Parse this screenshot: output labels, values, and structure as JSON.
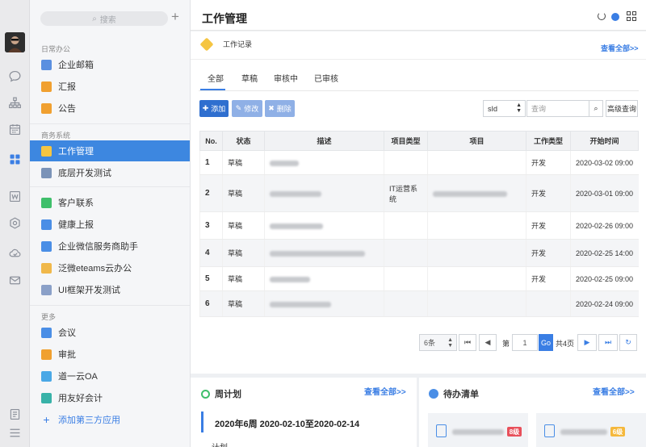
{
  "search": {
    "placeholder": "搜索",
    "icon": "search-icon"
  },
  "sidebar": {
    "sections": [
      "日常办公",
      "商务系统",
      "更多"
    ],
    "items": [
      {
        "label": "企业邮箱",
        "color": "#5a8fe0"
      },
      {
        "label": "汇报",
        "color": "#f0a030"
      },
      {
        "label": "公告",
        "color": "#f0a030"
      },
      {
        "label": "工作管理",
        "color": "#f5c542"
      },
      {
        "label": "底层开发测试",
        "color": "#7b93b8"
      },
      {
        "label": "客户联系",
        "color": "#3fbf6b"
      },
      {
        "label": "健康上报",
        "color": "#4a8ee6"
      },
      {
        "label": "企业微信服务商助手",
        "color": "#4a8ee6"
      },
      {
        "label": "泛微eteams云办公",
        "color": "#f0b84a"
      },
      {
        "label": "UI框架开发测试",
        "color": "#8aa0c8"
      },
      {
        "label": "会议",
        "color": "#4a8ee6"
      },
      {
        "label": "审批",
        "color": "#f0a030"
      },
      {
        "label": "道一云OA",
        "color": "#4aa8e6"
      },
      {
        "label": "用友好会计",
        "color": "#38b2a8"
      }
    ],
    "add_app": "添加第三方应用"
  },
  "header": {
    "title": "工作管理"
  },
  "work_record": {
    "title": "工作记录",
    "view_all": "查看全部>>"
  },
  "tabs": [
    "全部",
    "草稿",
    "审核中",
    "已审核"
  ],
  "toolbar": {
    "add": "添加",
    "edit": "修改",
    "delete": "删除",
    "field_select": "sId",
    "query_placeholder": "查询",
    "advanced": "高级查询"
  },
  "table": {
    "columns": [
      "No.",
      "状态",
      "描述",
      "项目类型",
      "项目",
      "工作类型",
      "开始时间"
    ],
    "rows": [
      {
        "no": "1",
        "status": "草稿",
        "project_type": "",
        "work_type": "开发",
        "start": "2020-03-02 09:00"
      },
      {
        "no": "2",
        "status": "草稿",
        "project_type": "IT运营系统",
        "work_type": "开发",
        "start": "2020-03-01 09:00"
      },
      {
        "no": "3",
        "status": "草稿",
        "project_type": "",
        "work_type": "开发",
        "start": "2020-02-26 09:00"
      },
      {
        "no": "4",
        "status": "草稿",
        "project_type": "",
        "work_type": "开发",
        "start": "2020-02-25 14:00"
      },
      {
        "no": "5",
        "status": "草稿",
        "project_type": "",
        "work_type": "开发",
        "start": "2020-02-25 09:00"
      },
      {
        "no": "6",
        "status": "草稿",
        "project_type": "",
        "work_type": "",
        "start": "2020-02-24 09:00"
      }
    ]
  },
  "pagination": {
    "page_size": "6条",
    "page_label": "第",
    "page": "1",
    "go": "Go",
    "total": "共4页"
  },
  "weekly": {
    "title": "周计划",
    "view_all": "查看全部>>",
    "period": "2020年6周 2020-02-10至2020-02-14",
    "sub": "计划"
  },
  "todo": {
    "title": "待办清单",
    "view_all": "查看全部>>",
    "badges": [
      "8级",
      "6级"
    ]
  },
  "colors": {
    "accent": "#3a7ee4",
    "active_bg": "#3d87e0",
    "badge_red": "#e8505b",
    "badge_yellow": "#f5b83c"
  }
}
